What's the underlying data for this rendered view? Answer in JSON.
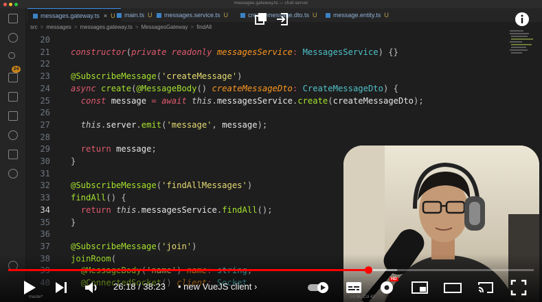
{
  "window": {
    "title": "messages.gateway.ts — chat-server"
  },
  "tabs": [
    {
      "label": "messages.gateway.ts",
      "mark": "U",
      "close": "×",
      "active": true
    },
    {
      "label": "main.ts",
      "mark": "U",
      "active": false
    },
    {
      "label": "messages.service.ts",
      "mark": "U",
      "active": false
    },
    {
      "label": "create-message.dto.ts",
      "mark": "U",
      "active": false
    },
    {
      "label": "message.entity.ts",
      "mark": "U",
      "active": false
    }
  ],
  "breadcrumb": {
    "items": [
      "src",
      "messages",
      "messages.gateway.ts",
      "MessagesGateway",
      "findAll"
    ],
    "sep": ">"
  },
  "activity": {
    "scm_badge": "24"
  },
  "editor": {
    "current_line": "34",
    "lines": [
      {
        "n": "20",
        "tokens": []
      },
      {
        "n": "21",
        "tokens": [
          [
            "kw",
            "constructor"
          ],
          [
            "punc",
            "("
          ],
          [
            "kw",
            "private "
          ],
          [
            "kw",
            "readonly "
          ],
          [
            "param",
            "messagesService"
          ],
          [
            "op",
            ": "
          ],
          [
            "type",
            "MessagesService"
          ],
          [
            "punc",
            ") {}"
          ]
        ]
      },
      {
        "n": "22",
        "tokens": []
      },
      {
        "n": "23",
        "tokens": [
          [
            "dec",
            "@SubscribeMessage"
          ],
          [
            "punc",
            "("
          ],
          [
            "str",
            "'createMessage'"
          ],
          [
            "punc",
            ")"
          ]
        ]
      },
      {
        "n": "24",
        "tokens": [
          [
            "kw",
            "async "
          ],
          [
            "fn",
            "create"
          ],
          [
            "punc",
            "("
          ],
          [
            "dec",
            "@MessageBody"
          ],
          [
            "punc",
            "() "
          ],
          [
            "param",
            "createMessageDto"
          ],
          [
            "op",
            ": "
          ],
          [
            "type",
            "CreateMessageDto"
          ],
          [
            "punc",
            ") {"
          ]
        ]
      },
      {
        "n": "25",
        "indent": "  ",
        "tokens": [
          [
            "kw",
            "const "
          ],
          [
            "var",
            "message "
          ],
          [
            "op",
            "= "
          ],
          [
            "kw",
            "await "
          ],
          [
            "this",
            "this"
          ],
          [
            "punc",
            "."
          ],
          [
            "var",
            "messagesService"
          ],
          [
            "punc",
            "."
          ],
          [
            "fn",
            "create"
          ],
          [
            "punc",
            "("
          ],
          [
            "var",
            "createMessageDto"
          ],
          [
            "punc",
            ");"
          ]
        ]
      },
      {
        "n": "26",
        "tokens": []
      },
      {
        "n": "27",
        "indent": "  ",
        "tokens": [
          [
            "this",
            "this"
          ],
          [
            "punc",
            "."
          ],
          [
            "var",
            "server"
          ],
          [
            "punc",
            "."
          ],
          [
            "fn",
            "emit"
          ],
          [
            "punc",
            "("
          ],
          [
            "str",
            "'message'"
          ],
          [
            "punc",
            ", "
          ],
          [
            "var",
            "message"
          ],
          [
            "punc",
            ");"
          ]
        ]
      },
      {
        "n": "28",
        "tokens": []
      },
      {
        "n": "29",
        "indent": "  ",
        "tokens": [
          [
            "op",
            "return "
          ],
          [
            "var",
            "message"
          ],
          [
            "punc",
            ";"
          ]
        ]
      },
      {
        "n": "30",
        "tokens": [
          [
            "punc",
            "}"
          ]
        ]
      },
      {
        "n": "31",
        "tokens": []
      },
      {
        "n": "32",
        "tokens": [
          [
            "dec",
            "@SubscribeMessage"
          ],
          [
            "punc",
            "("
          ],
          [
            "str",
            "'findAllMessages'"
          ],
          [
            "punc",
            ")"
          ]
        ]
      },
      {
        "n": "33",
        "tokens": [
          [
            "fn",
            "findAll"
          ],
          [
            "punc",
            "() {"
          ]
        ]
      },
      {
        "n": "34",
        "indent": "  ",
        "tokens": [
          [
            "op",
            "return "
          ],
          [
            "this",
            "this"
          ],
          [
            "punc",
            "."
          ],
          [
            "var",
            "messagesService"
          ],
          [
            "punc",
            "."
          ],
          [
            "fn",
            "findAll"
          ],
          [
            "punc",
            "();"
          ]
        ]
      },
      {
        "n": "35",
        "tokens": [
          [
            "punc",
            "}"
          ]
        ]
      },
      {
        "n": "36",
        "tokens": []
      },
      {
        "n": "37",
        "tokens": [
          [
            "dec",
            "@SubscribeMessage"
          ],
          [
            "punc",
            "("
          ],
          [
            "str",
            "'join'"
          ],
          [
            "punc",
            ")"
          ]
        ]
      },
      {
        "n": "38",
        "tokens": [
          [
            "fn",
            "joinRoom"
          ],
          [
            "punc",
            "("
          ]
        ]
      },
      {
        "n": "39",
        "indent": "  ",
        "tokens": [
          [
            "dec",
            "@MessageBody"
          ],
          [
            "punc",
            "("
          ],
          [
            "str",
            "'name'"
          ],
          [
            "punc",
            ") "
          ],
          [
            "param",
            "name"
          ],
          [
            "op",
            ": "
          ],
          [
            "type",
            "string"
          ],
          [
            "punc",
            ","
          ]
        ]
      },
      {
        "n": "40",
        "indent": "  ",
        "tokens": [
          [
            "dec",
            "@ConnectedSocket"
          ],
          [
            "punc",
            "() "
          ],
          [
            "param",
            "client"
          ],
          [
            "op",
            ": "
          ],
          [
            "type",
            "Socket"
          ]
        ]
      }
    ]
  },
  "player": {
    "time": "26:18 / 38:23",
    "chapter": "• new VueJS client",
    "chapter_arrow": "›",
    "hd_badge": "HD",
    "progress": 0.686,
    "buffered": 0.74,
    "colors": {
      "accent": "#ff0000"
    }
  },
  "statusbar": {
    "left": "master*",
    "right": "Ln 34, Col 43"
  }
}
